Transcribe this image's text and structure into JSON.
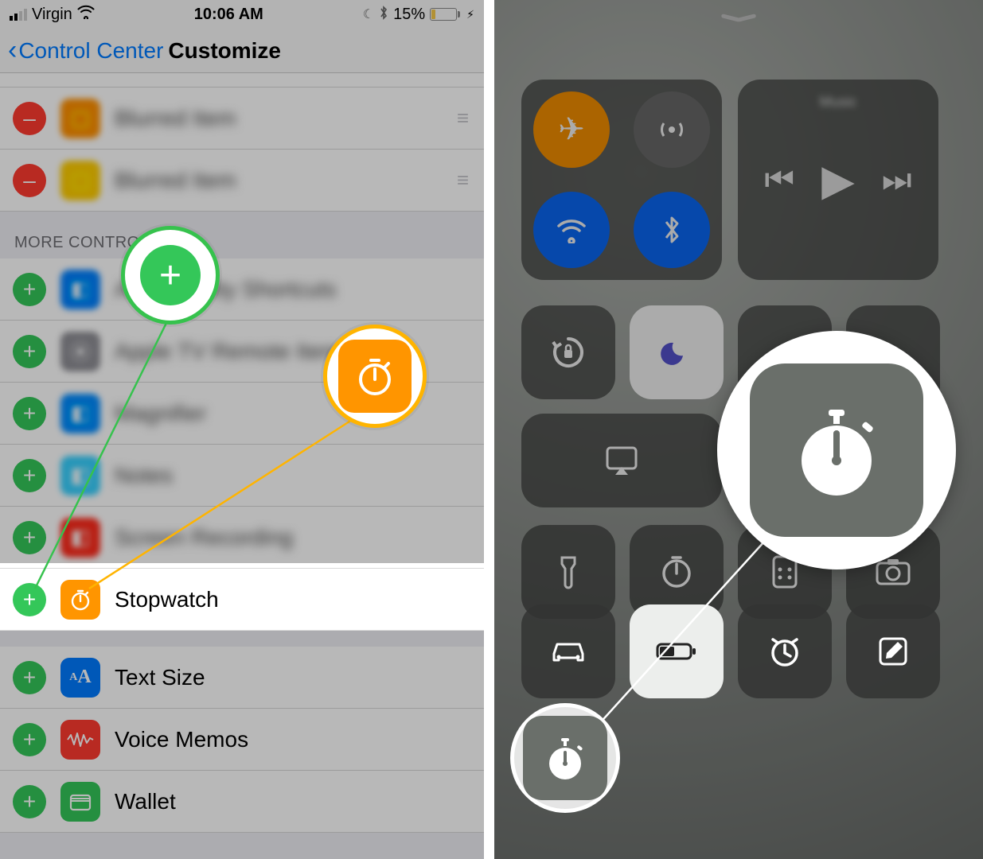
{
  "status_bar": {
    "carrier": "Virgin",
    "time": "10:06 AM",
    "battery_percent": "15%"
  },
  "nav": {
    "back_label": "Control Center",
    "title": "Customize"
  },
  "section_header": "MORE CONTROLS",
  "rows": {
    "stopwatch": "Stopwatch",
    "text_size": "Text Size",
    "voice_memos": "Voice Memos",
    "wallet": "Wallet"
  },
  "callouts": {
    "add_symbol": "+",
    "stopwatch_icon": "stopwatch-icon"
  },
  "control_center": {
    "stopwatch_icon": "stopwatch-icon"
  }
}
